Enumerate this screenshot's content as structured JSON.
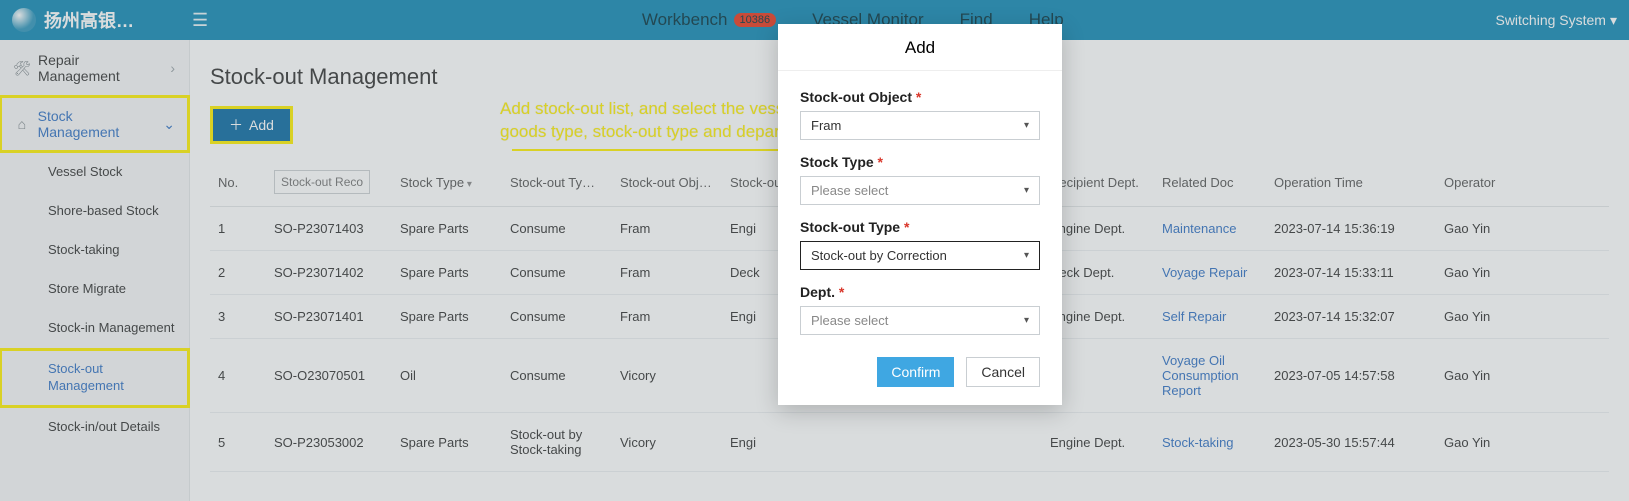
{
  "brand": "扬州高银…",
  "topnav": {
    "workbench": "Workbench",
    "workbench_badge": "10386",
    "vessel_monitor": "Vessel Monitor",
    "find": "Find",
    "help": "Help"
  },
  "switching": "Switching System",
  "sidebar": {
    "repair": "Repair Management",
    "stock": "Stock Management",
    "items": [
      "Vessel Stock",
      "Shore-based Stock",
      "Stock-taking",
      "Store Migrate",
      "Stock-in Management",
      "Stock-out Management",
      "Stock-in/out Details"
    ]
  },
  "page_title": "Stock-out Management",
  "add_button": "Add",
  "annotation_text": "Add stock-out list, and select the vessel name,\ngoods type, stock-out type and department",
  "table": {
    "headers": {
      "no": "No.",
      "recor_placeholder": "Stock-out Recor",
      "stock_type": "Stock Type",
      "stockout_type": "Stock-out Ty…",
      "stockout_obj": "Stock-out Obj…",
      "stockout_dept": "Stock-out De…",
      "recipient_dept": "Recipient Dept.",
      "related_doc": "Related Doc",
      "op_time": "Operation Time",
      "operator": "Operator"
    },
    "rows": [
      {
        "no": "1",
        "recor": "SO-P23071403",
        "stock_type": "Spare Parts",
        "stockout_type": "Consume",
        "obj": "Fram",
        "dept": "Engi",
        "recipient": "Engine Dept.",
        "doc": "Maintenance",
        "time": "2023-07-14 15:36:19",
        "op": "Gao Yin"
      },
      {
        "no": "2",
        "recor": "SO-P23071402",
        "stock_type": "Spare Parts",
        "stockout_type": "Consume",
        "obj": "Fram",
        "dept": "Deck",
        "recipient": "Deck Dept.",
        "doc": "Voyage Repair",
        "time": "2023-07-14 15:33:11",
        "op": "Gao Yin"
      },
      {
        "no": "3",
        "recor": "SO-P23071401",
        "stock_type": "Spare Parts",
        "stockout_type": "Consume",
        "obj": "Fram",
        "dept": "Engi",
        "recipient": "Engine Dept.",
        "doc": "Self Repair",
        "time": "2023-07-14 15:32:07",
        "op": "Gao Yin"
      },
      {
        "no": "4",
        "recor": "SO-O23070501",
        "stock_type": "Oil",
        "stockout_type": "Consume",
        "obj": "Vicory",
        "dept": "",
        "recipient": "",
        "doc": "Voyage Oil Consumption Report",
        "time": "2023-07-05 14:57:58",
        "op": "Gao Yin"
      },
      {
        "no": "5",
        "recor": "SO-P23053002",
        "stock_type": "Spare Parts",
        "stockout_type": "Stock-out by Stock-taking",
        "obj": "Vicory",
        "dept": "Engi",
        "recipient": "Engine Dept.",
        "doc": "Stock-taking",
        "time": "2023-05-30 15:57:44",
        "op": "Gao Yin"
      }
    ]
  },
  "dialog": {
    "title": "Add",
    "fields": {
      "stockout_object": {
        "label": "Stock-out Object",
        "value": "Fram"
      },
      "stock_type": {
        "label": "Stock Type",
        "value": "Please select"
      },
      "stockout_type": {
        "label": "Stock-out Type",
        "value": "Stock-out by Correction"
      },
      "dept": {
        "label": "Dept.",
        "value": "Please select"
      }
    },
    "confirm": "Confirm",
    "cancel": "Cancel"
  }
}
